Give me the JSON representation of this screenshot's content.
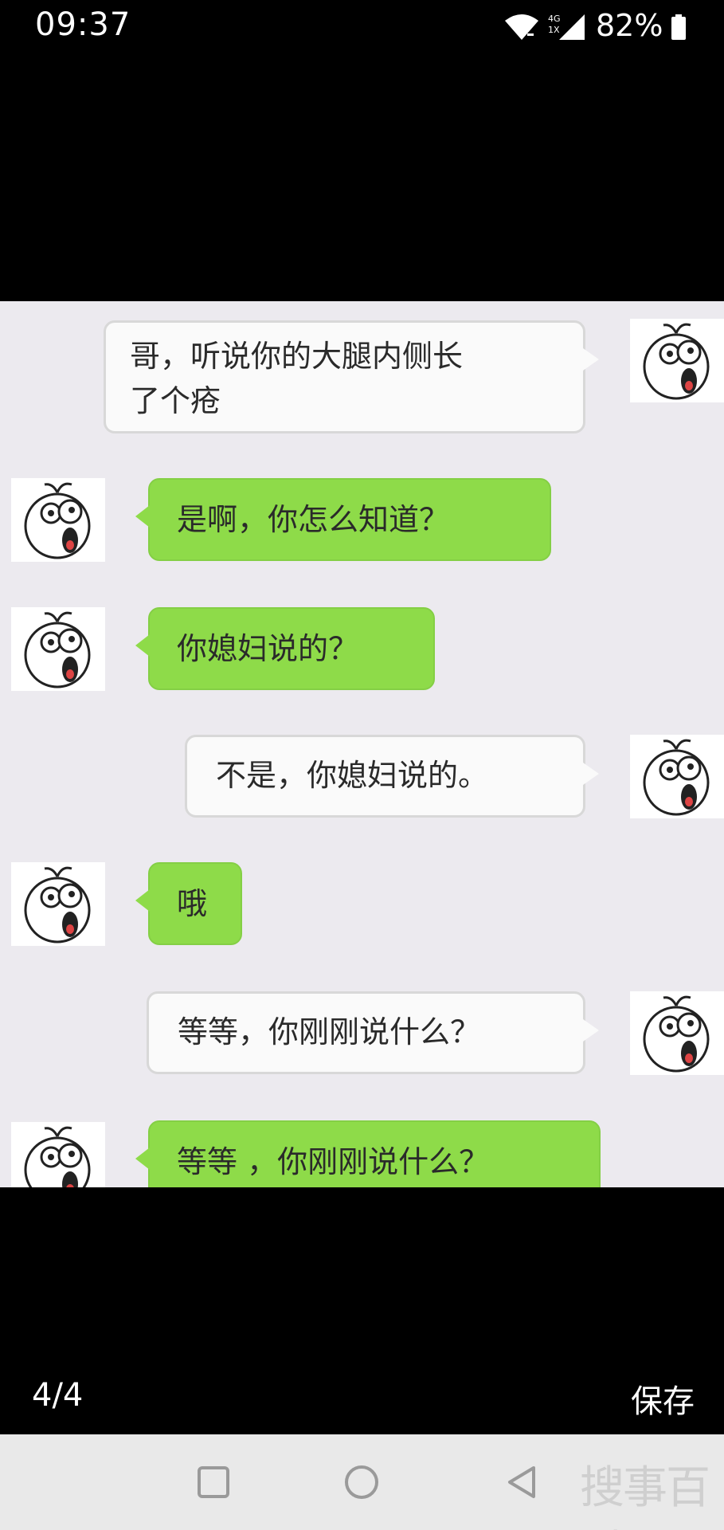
{
  "status_bar": {
    "time": "09:37",
    "network_top": "4G",
    "network_bottom": "1X",
    "battery": "82%",
    "icons": [
      "wifi-icon",
      "signal-icon",
      "battery-icon"
    ]
  },
  "viewer": {
    "page_counter": "4/4",
    "save_label": "保存"
  },
  "chat": {
    "messages": [
      {
        "side": "right",
        "text_line1": "哥，听说你的大腿内侧长",
        "text_line2": "了个疮"
      },
      {
        "side": "left",
        "text": "是啊，你怎么知道？"
      },
      {
        "side": "left",
        "text": "你媳妇说的？"
      },
      {
        "side": "right",
        "text": "不是，你媳妇说的。"
      },
      {
        "side": "left",
        "text": "哦"
      },
      {
        "side": "right",
        "text": "等等，你刚刚说什么？"
      },
      {
        "side": "left",
        "text": "等等 ，你刚刚说什么？"
      }
    ],
    "colors": {
      "incoming": "#8edb49",
      "outgoing": "#fafafa",
      "background": "#eceaef"
    }
  },
  "nav_bar": {
    "buttons": [
      "recent-apps-icon",
      "home-icon",
      "back-icon"
    ],
    "watermark": "搜事百科"
  }
}
